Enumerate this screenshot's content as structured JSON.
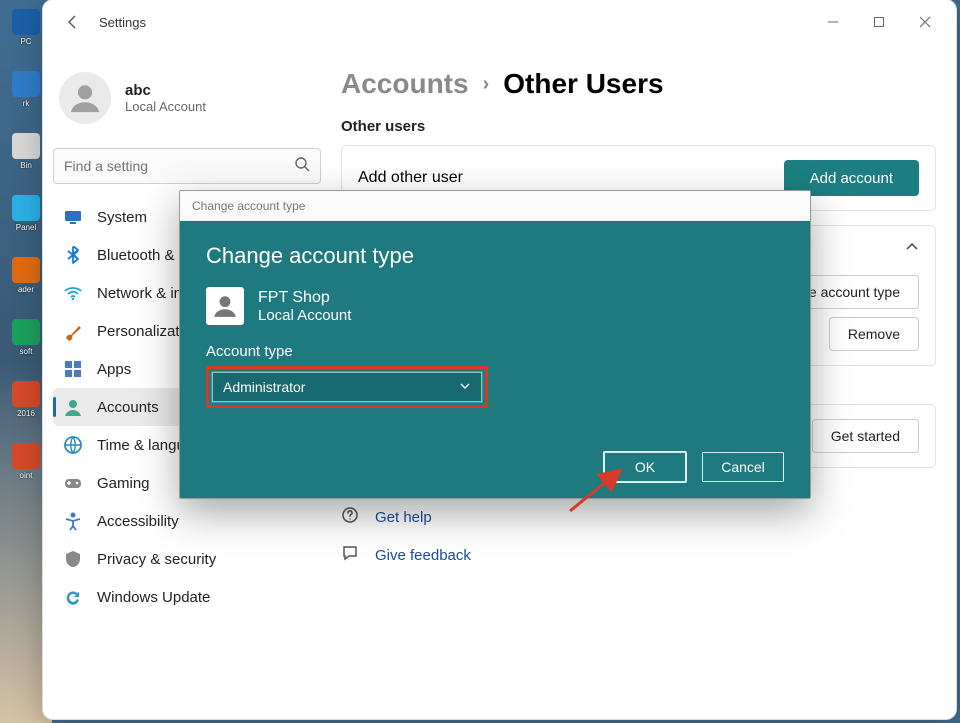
{
  "app": {
    "title": "Settings"
  },
  "profile": {
    "name": "abc",
    "sub": "Local Account"
  },
  "search": {
    "placeholder": "Find a setting"
  },
  "sidebar": {
    "items": [
      {
        "label": "System"
      },
      {
        "label": "Bluetooth & devices"
      },
      {
        "label": "Network & internet"
      },
      {
        "label": "Personalization"
      },
      {
        "label": "Apps"
      },
      {
        "label": "Accounts"
      },
      {
        "label": "Time & language"
      },
      {
        "label": "Gaming"
      },
      {
        "label": "Accessibility"
      },
      {
        "label": "Privacy & security"
      },
      {
        "label": "Windows Update"
      }
    ],
    "active_index": 5
  },
  "breadcrumb": {
    "parent": "Accounts",
    "current": "Other Users"
  },
  "main": {
    "section_title": "Other users",
    "add_other_user": "Add other user",
    "add_account_button": "Add account",
    "change_type_button": "Change account type",
    "remove_button": "Remove",
    "get_started_button": "Get started",
    "get_help": "Get help",
    "give_feedback": "Give feedback"
  },
  "dialog": {
    "window_title": "Change account type",
    "heading": "Change account type",
    "user_name": "FPT Shop",
    "user_sub": "Local Account",
    "field_label": "Account type",
    "selected_value": "Administrator",
    "ok": "OK",
    "cancel": "Cancel"
  },
  "desktop_icons": [
    {
      "label": "PC",
      "color": "#1a60a6"
    },
    {
      "label": "rk",
      "color": "#2f7bc9"
    },
    {
      "label": "Bin",
      "color": "#d7d7d7"
    },
    {
      "label": "Panel",
      "color": "#2bb0e6"
    },
    {
      "label": "ader",
      "color": "#e06a12"
    },
    {
      "label": "soft",
      "color": "#1aa05c"
    },
    {
      "label": "2016",
      "color": "#d64a27"
    },
    {
      "label": "oint",
      "color": "#d64a27"
    }
  ]
}
